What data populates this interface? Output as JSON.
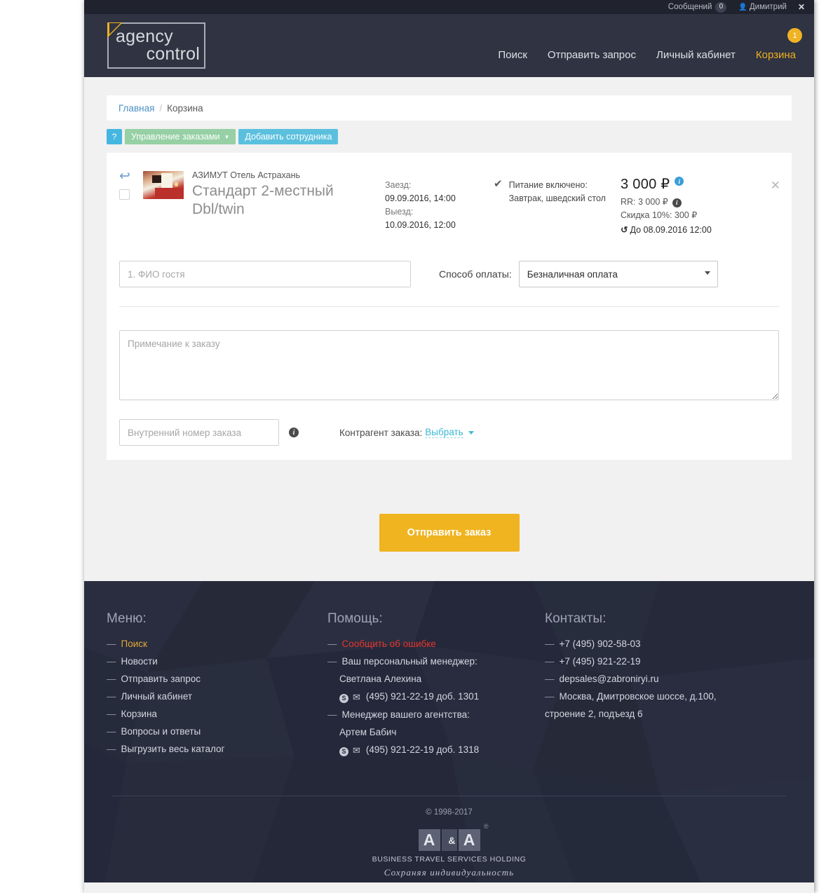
{
  "topbar": {
    "messages_label": "Сообщений",
    "messages_count": "0",
    "user_name": "Димитрий",
    "close_label": "✕"
  },
  "masthead": {
    "logo_line1": "agency",
    "logo_line2": "control",
    "nav": [
      {
        "label": "Поиск",
        "active": false
      },
      {
        "label": "Отправить запрос",
        "active": false
      },
      {
        "label": "Личный кабинет",
        "active": false
      },
      {
        "label": "Корзина",
        "active": true
      }
    ],
    "cart_badge": "1"
  },
  "breadcrumb": {
    "home": "Главная",
    "separator": "/",
    "current": "Корзина"
  },
  "toolbar": {
    "help_label": "?",
    "manage_orders": "Управление заказами",
    "add_employee": "Добавить сотрудника"
  },
  "booking": {
    "hotel_name": "АЗИМУТ Отель Астрахань",
    "room_name": "Стандарт 2-местный Dbl/twin",
    "checkin_label": "Заезд:",
    "checkin_value": "09.09.2016, 14:00",
    "checkout_label": "Выезд:",
    "checkout_value": "10.09.2016, 12:00",
    "meal_title": "Питание включено:",
    "meal_value": "Завтрак, шведский стол",
    "price": "3 000 ₽",
    "rr_line": "RR: 3 000 ₽",
    "discount_line": "Скидка 10%: 300 ₽",
    "deadline": "До 08.09.2016 12:00",
    "remove_label": "✕"
  },
  "form": {
    "guest_placeholder": "1. ФИО гостя",
    "guest_value": "",
    "payment_label": "Способ оплаты:",
    "payment_selected": "Безналичная оплата",
    "payment_options": [
      "Безналичная оплата"
    ],
    "note_placeholder": "Примечание к заказу",
    "note_value": "",
    "internal_number_placeholder": "Внутренний номер заказа",
    "internal_number_value": "",
    "counterparty_label": "Контрагент заказа:",
    "counterparty_link": "Выбрать",
    "submit_label": "Отправить заказ"
  },
  "footer": {
    "menu": {
      "heading": "Меню:",
      "items": [
        {
          "label": "Поиск",
          "style": "gold"
        },
        {
          "label": "Новости",
          "style": "plain"
        },
        {
          "label": "Отправить запрос",
          "style": "plain"
        },
        {
          "label": "Личный кабинет",
          "style": "plain"
        },
        {
          "label": "Корзина",
          "style": "plain"
        },
        {
          "label": "Вопросы и ответы",
          "style": "plain"
        },
        {
          "label": "Выгрузить весь каталог",
          "style": "plain"
        }
      ]
    },
    "help": {
      "heading": "Помощь:",
      "report_error": "Сообщить об ошибке",
      "personal_manager_label": "Ваш персональный менеджер:",
      "personal_manager_name": "Светлана Алехина",
      "personal_manager_phone": "(495) 921-22-19 доб. 1301",
      "agency_manager_label": "Менеджер вашего агентства:",
      "agency_manager_name": "Артем Бабич",
      "agency_manager_phone": "(495) 921-22-19 доб. 1318"
    },
    "contacts": {
      "heading": "Контакты:",
      "items": [
        "+7 (495) 902-58-03",
        "+7 (495) 921-22-19",
        "depsales@zabroniryi.ru",
        "Москва, Дмитровское шоссе, д.100, строение 2, подъезд 6"
      ]
    },
    "copyright": "© 1998-2017",
    "brand_a1": "A",
    "brand_amp": "&",
    "brand_a2": "A",
    "brand_reg": "®",
    "brand_sub": "BUSINESS TRAVEL SERVICES HOLDING",
    "brand_slogan": "Сохраняя индивидуальность"
  },
  "colors": {
    "accent_gold": "#efb41f",
    "masthead": "#2f3342",
    "topbar": "#20232e",
    "footer": "#272b3a",
    "link_blue": "#4a90c4",
    "info_blue": "#3b9ed8",
    "btn_green": "#96d0a4",
    "btn_blue": "#5bc0de",
    "error_red": "#e7352b"
  }
}
